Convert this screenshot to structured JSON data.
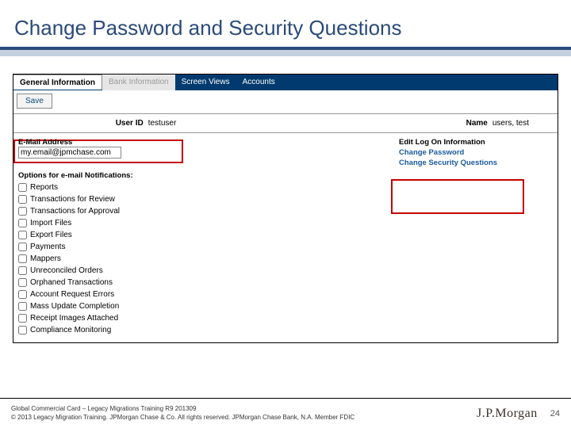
{
  "slide": {
    "title": "Change Password and Security Questions",
    "page_number": "24"
  },
  "tabs": {
    "t0": "General Information",
    "t1": "Bank Information",
    "t2": "Screen Views",
    "t3": "Accounts"
  },
  "toolbar": {
    "save": "Save"
  },
  "info": {
    "user_id_label": "User ID",
    "user_id_value": "testuser",
    "name_label": "Name",
    "name_value": "users, test"
  },
  "email": {
    "label": "E-Mail Address",
    "value": "my.email@jpmchase.com"
  },
  "options": {
    "header": "Options for e-mail Notifications:",
    "o0": "Reports",
    "o1": "Transactions for Review",
    "o2": "Transactions for Approval",
    "o3": "Import Files",
    "o4": "Export Files",
    "o5": "Payments",
    "o6": "Mappers",
    "o7": "Unreconciled Orders",
    "o8": "Orphaned Transactions",
    "o9": "Account Request Errors",
    "o10": "Mass Update Completion",
    "o11": "Receipt Images Attached",
    "o12": "Compliance Monitoring"
  },
  "editlogon": {
    "header": "Edit Log On Information",
    "link_pwd": "Change Password",
    "link_sec": "Change Security Questions"
  },
  "footer": {
    "line1": "Global Commercial Card – Legacy Migrations Training R9 201309",
    "line2": "© 2013 Legacy Migration Training. JPMorgan Chase & Co. All rights reserved. JPMorgan Chase Bank, N.A. Member FDIC",
    "logo": "J.P.Morgan"
  }
}
